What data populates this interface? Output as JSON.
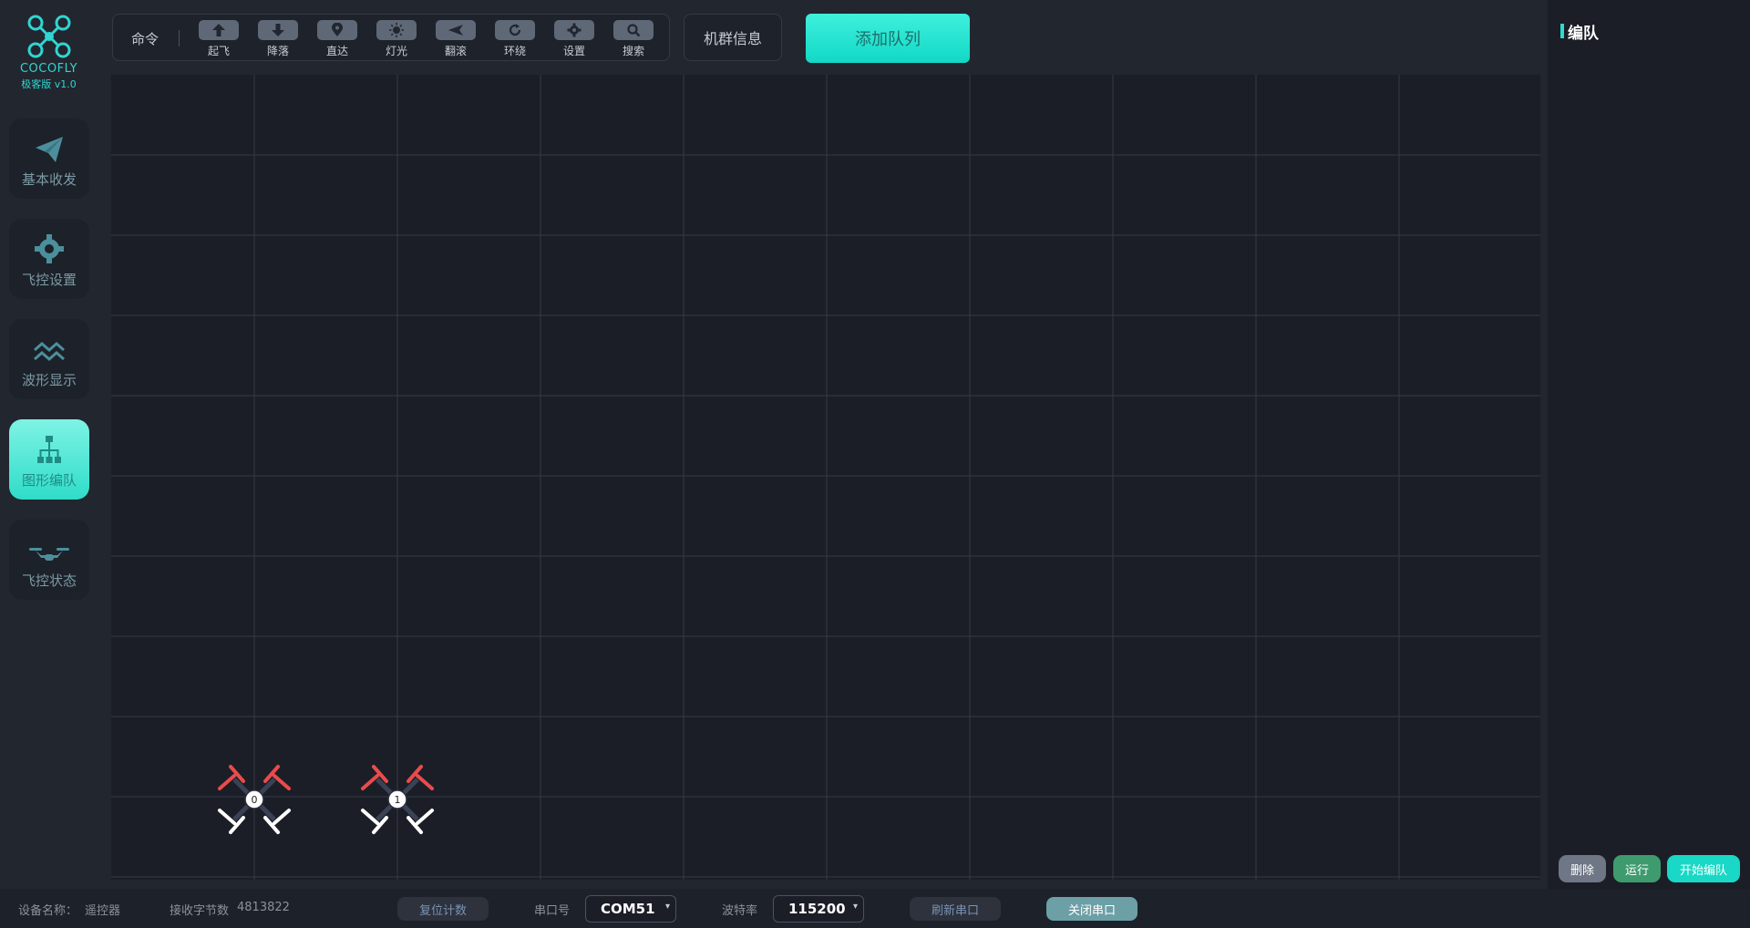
{
  "brand": {
    "name": "COCOFLY",
    "version": "极客版 v1.0"
  },
  "sidebar": {
    "items": [
      {
        "label": "基本收发",
        "icon": "paper-plane-icon"
      },
      {
        "label": "飞控设置",
        "icon": "gear-icon"
      },
      {
        "label": "波形显示",
        "icon": "waveform-icon"
      },
      {
        "label": "图形编队",
        "icon": "org-chart-icon",
        "active": true
      },
      {
        "label": "飞控状态",
        "icon": "drone-icon"
      }
    ]
  },
  "toolbar": {
    "command_label": "命令",
    "commands": [
      {
        "label": "起飞",
        "icon": "arrow-up-icon"
      },
      {
        "label": "降落",
        "icon": "arrow-down-icon"
      },
      {
        "label": "直达",
        "icon": "location-pin-icon"
      },
      {
        "label": "灯光",
        "icon": "sun-icon"
      },
      {
        "label": "翻滚",
        "icon": "flip-icon"
      },
      {
        "label": "环绕",
        "icon": "circle-arrow-icon"
      },
      {
        "label": "设置",
        "icon": "gear-icon"
      },
      {
        "label": "搜索",
        "icon": "search-icon"
      }
    ],
    "swarm_info_label": "机群信息",
    "add_queue_label": "添加队列"
  },
  "canvas": {
    "drones": [
      {
        "id": "0"
      },
      {
        "id": "1"
      }
    ]
  },
  "right_panel": {
    "title": "编队",
    "delete_label": "删除",
    "run_label": "运行",
    "start_label": "开始编队"
  },
  "statusbar": {
    "device_label": "设备名称：",
    "device_value": "遥控器",
    "bytes_label": "接收字节数",
    "bytes_value": "4813822",
    "reset_label": "复位计数",
    "port_label": "串口号",
    "port_value": "COM51",
    "baud_label": "波特率",
    "baud_value": "115200",
    "refresh_label": "刷新串口",
    "close_label": "关闭串口"
  },
  "colors": {
    "accent": "#2fdcc9",
    "background": "#22262f",
    "canvas": "#1b1e27",
    "propeller_front": "#e94b4b"
  }
}
